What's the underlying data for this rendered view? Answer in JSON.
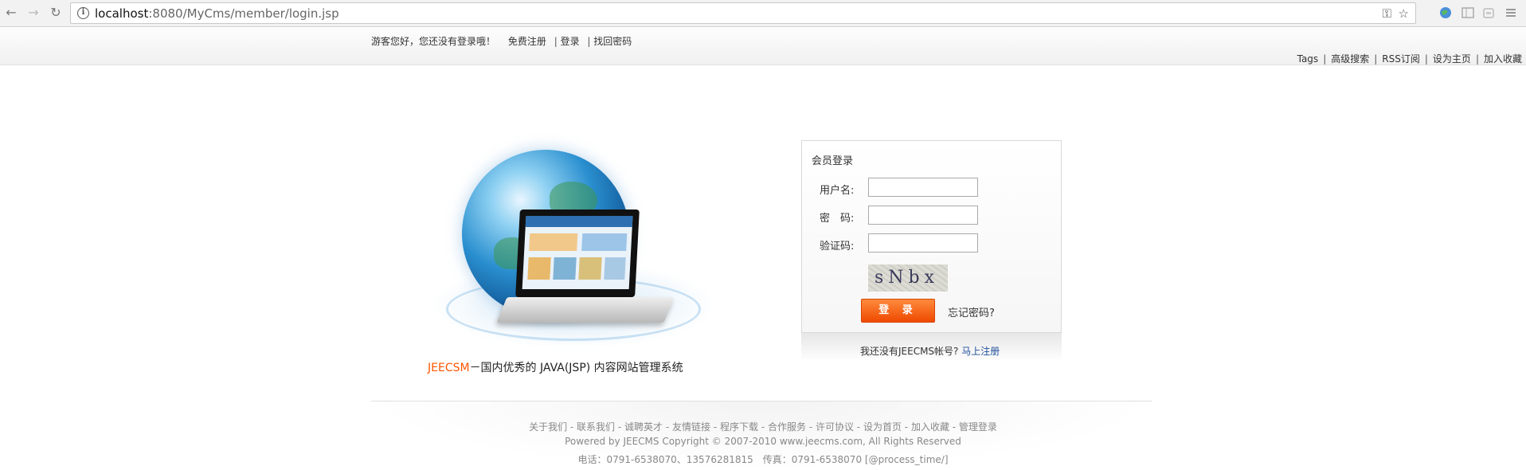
{
  "browser": {
    "url_host": "localhost",
    "url_path": ":8080/MyCms/member/login.jsp",
    "back_icon": "←",
    "forward_icon": "→",
    "reload_icon": "↻",
    "info_icon": "i",
    "key_icon": "⚿",
    "star_icon": "☆"
  },
  "topbar": {
    "welcome": "游客您好，您还没有登录哦！",
    "register": "免费注册",
    "login": "登录",
    "find_password": "找回密码",
    "sep": "|",
    "links": [
      "Tags",
      "高级搜索",
      "RSS订阅",
      "设为主页",
      "加入收藏"
    ]
  },
  "hero": {
    "brand": "JEECSM",
    "tagline": "－国内优秀的 JAVA(JSP) 内容网站管理系统"
  },
  "login": {
    "title": "会员登录",
    "username_label": "用户名:",
    "password_label": "密　码:",
    "captcha_label": "验证码:",
    "username_value": "",
    "password_value": "",
    "captcha_value": "",
    "captcha_image_text": "sNbx",
    "submit": "登 录",
    "forgot": "忘记密码?",
    "no_account": "我还没有JEECMS帐号?",
    "register_now": "马上注册"
  },
  "footer": {
    "links": [
      "关于我们",
      "联系我们",
      "诚聘英才",
      "友情链接",
      "程序下载",
      "合作服务",
      "许可协议",
      "设为首页",
      "加入收藏",
      "管理登录"
    ],
    "copyright": "Powered by JEECMS Copyright © 2007-2010 www.jeecms.com, All Rights Reserved",
    "phone": "电话：0791-6538070、13576281815　传真：0791-6538070 [@process_time/]"
  },
  "colors": {
    "brand": "#ff5500",
    "button": "#ee4a00",
    "link": "#1f4f9a"
  }
}
